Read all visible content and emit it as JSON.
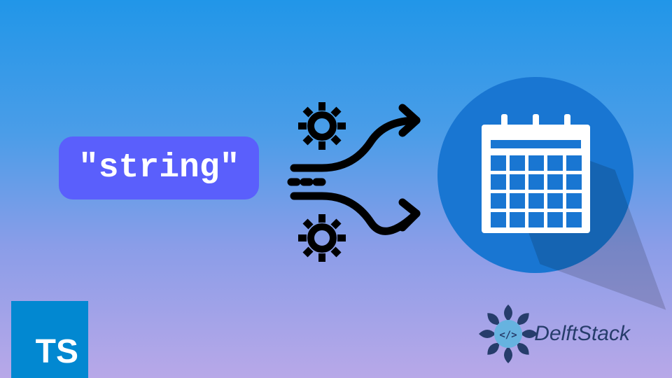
{
  "string_label": "\"string\"",
  "ts_logo_text": "TS",
  "delft_brand": "DelftStack",
  "colors": {
    "string_box_bg": "#5a5ffc",
    "calendar_circle_bg": "#1976d2",
    "ts_logo_bg": "#0288d1",
    "delft_text": "#263d6b"
  },
  "icons": {
    "gear_top": "gear-icon",
    "gear_bottom": "gear-icon",
    "shuffle_arrows": "shuffle-arrows-icon",
    "calendar": "calendar-icon",
    "typescript": "typescript-logo",
    "delft_rosette": "delftstack-rosette-icon"
  }
}
